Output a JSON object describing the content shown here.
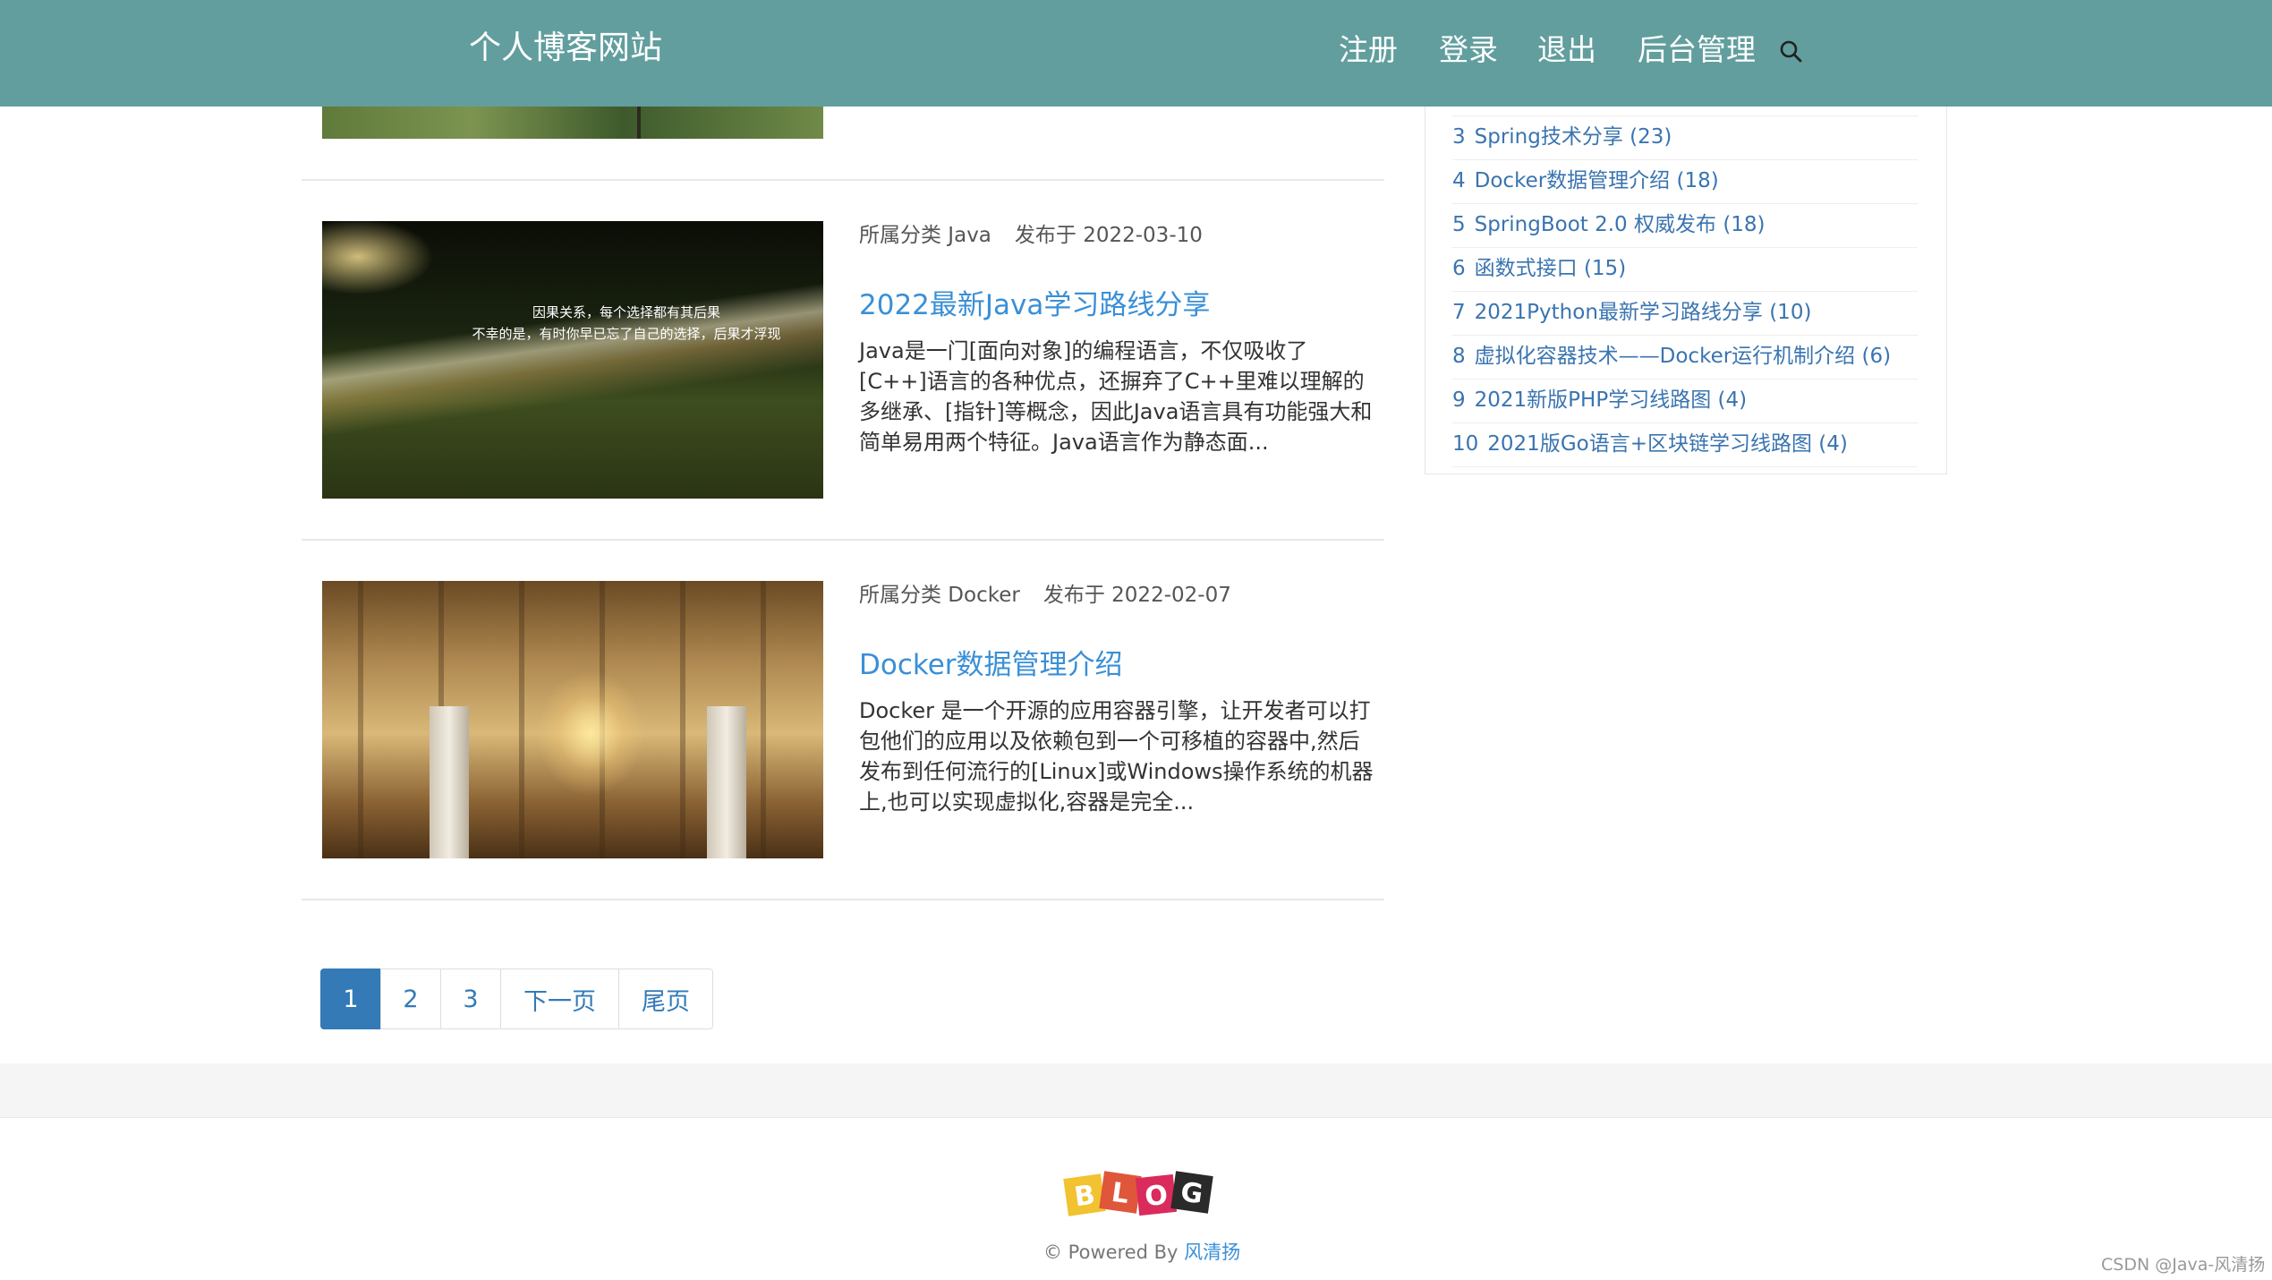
{
  "header": {
    "brand": "个人博客网站",
    "nav": [
      "注册",
      "登录",
      "退出",
      "后台管理"
    ],
    "search_icon": "search-icon"
  },
  "articles": [
    {
      "category_label": "所属分类 Java",
      "date_label": "发布于 2022-03-10",
      "title": "2022最新Java学习路线分享",
      "excerpt": "Java是一门[面向对象]的编程语言，不仅吸收了[C++]语言的各种优点，还摒弃了C++里难以理解的多继承、[指针]等概念，因此Java语言具有功能强大和简单易用两个特征。Java语言作为静态面...",
      "image_text": [
        "因果关系，每个选择都有其后果",
        "不幸的是，有时你早已忘了自己的选择，后果才浮现"
      ]
    },
    {
      "category_label": "所属分类 Docker",
      "date_label": "发布于 2022-02-07",
      "title": "Docker数据管理介绍",
      "excerpt": "Docker 是一个开源的应用容器引擎，让开发者可以打包他们的应用以及依赖包到一个可移植的容器中,然后发布到任何流行的[Linux]或Windows操作系统的机器上,也可以实现虚拟化,容器是完全..."
    }
  ],
  "pagination": {
    "pages": [
      "1",
      "2",
      "3"
    ],
    "next": "下一页",
    "last": "尾页",
    "active": "1"
  },
  "sidebar": {
    "items": [
      {
        "num": "3",
        "text": "Spring技术分享 (23)"
      },
      {
        "num": "4",
        "text": "Docker数据管理介绍 (18)"
      },
      {
        "num": "5",
        "text": "SpringBoot 2.0 权威发布 (18)"
      },
      {
        "num": "6",
        "text": "函数式接口 (15)"
      },
      {
        "num": "7",
        "text": "2021Python最新学习路线分享 (10)"
      },
      {
        "num": "8",
        "text": "虚拟化容器技术——Docker运行机制介绍 (6)"
      },
      {
        "num": "9",
        "text": "2021新版PHP学习线路图 (4)"
      },
      {
        "num": "10",
        "text": "2021版Go语言+区块链学习线路图 (4)"
      }
    ]
  },
  "footer": {
    "logo_letters": [
      "B",
      "L",
      "O",
      "G"
    ],
    "powered_prefix": "© Powered By",
    "author": "风清扬",
    "watermark": "CSDN @Java-风清扬"
  },
  "colors": {
    "navbar": "#629e9e",
    "link": "#3a8fd6",
    "pagination_active": "#337ab7"
  }
}
